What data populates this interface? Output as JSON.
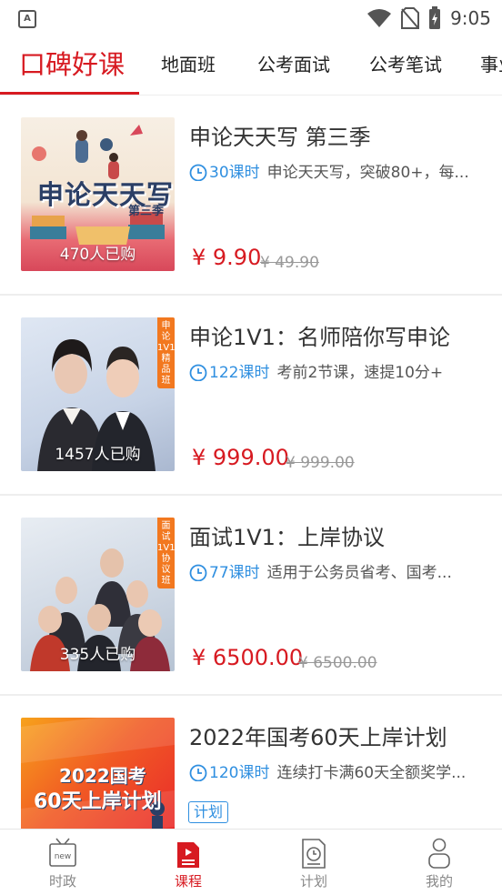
{
  "status_bar": {
    "time": "9:05",
    "app_icon_letter": "A"
  },
  "tabs": [
    {
      "label": "口碑好课",
      "active": true
    },
    {
      "label": "地面班"
    },
    {
      "label": "公考面试"
    },
    {
      "label": "公考笔试"
    },
    {
      "label": "事业"
    }
  ],
  "courses": [
    {
      "title": "申论天天写 第三季",
      "lessons": "30课时",
      "description": "申论天天写，突破80+，每...",
      "price": "¥ 9.90",
      "original_price": "¥ 49.90",
      "buyers": "470人已购",
      "thumb_caption_main": "申论天天写",
      "thumb_caption_sub": "第三季"
    },
    {
      "title": "申论1V1：名师陪你写申论",
      "lessons": "122课时",
      "description": "考前2节课，速提10分+",
      "price": "¥ 999.00",
      "original_price": "¥ 999.00",
      "buyers": "1457人已购",
      "side_badge": "申论1V1精品班"
    },
    {
      "title": "面试1V1：上岸协议",
      "lessons": "77课时",
      "description": "适用于公务员省考、国考...",
      "price": "¥ 6500.00",
      "original_price": "¥ 6500.00",
      "buyers": "335人已购",
      "side_badge": "面试1V1协议班"
    },
    {
      "title": "2022年国考60天上岸计划",
      "lessons": "120课时",
      "description": "连续打卡满60天全额奖学...",
      "tag": "计划",
      "thumb_caption_main": "2022国考",
      "thumb_caption_sub": "60天上岸计划"
    }
  ],
  "bottom_nav": [
    {
      "label": "时政",
      "icon": "tv-news-icon",
      "active": false
    },
    {
      "label": "课程",
      "icon": "course-icon",
      "active": true
    },
    {
      "label": "计划",
      "icon": "plan-clock-icon",
      "active": false
    },
    {
      "label": "我的",
      "icon": "profile-icon",
      "active": false
    }
  ],
  "colors": {
    "accent": "#d71a21",
    "link_blue": "#2f8fe0",
    "badge_orange": "#f2781f"
  }
}
